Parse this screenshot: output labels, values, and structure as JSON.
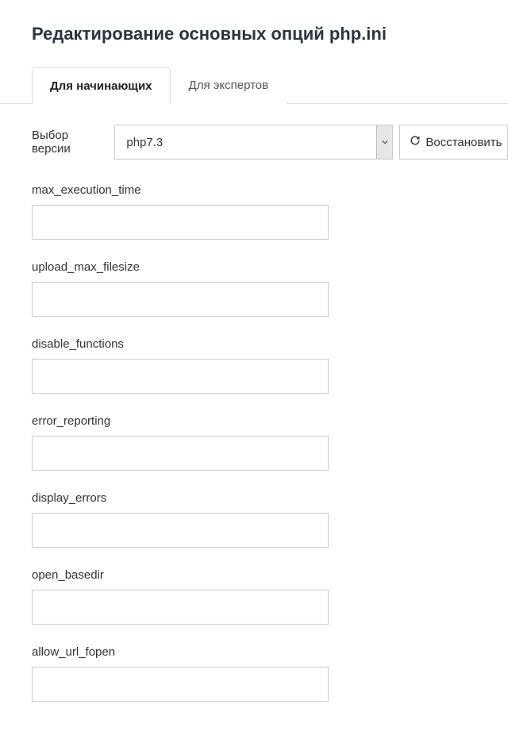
{
  "title": "Редактирование основных опций php.ini",
  "tabs": {
    "beginner": "Для начинающих",
    "expert": "Для экспертов"
  },
  "version": {
    "label": "Выбор версии",
    "selected": "php7.3"
  },
  "restore": {
    "label": "Восстановить"
  },
  "fields": [
    {
      "label": "max_execution_time",
      "value": ""
    },
    {
      "label": "upload_max_filesize",
      "value": ""
    },
    {
      "label": "disable_functions",
      "value": ""
    },
    {
      "label": "error_reporting",
      "value": ""
    },
    {
      "label": "display_errors",
      "value": ""
    },
    {
      "label": "open_basedir",
      "value": ""
    },
    {
      "label": "allow_url_fopen",
      "value": ""
    }
  ]
}
